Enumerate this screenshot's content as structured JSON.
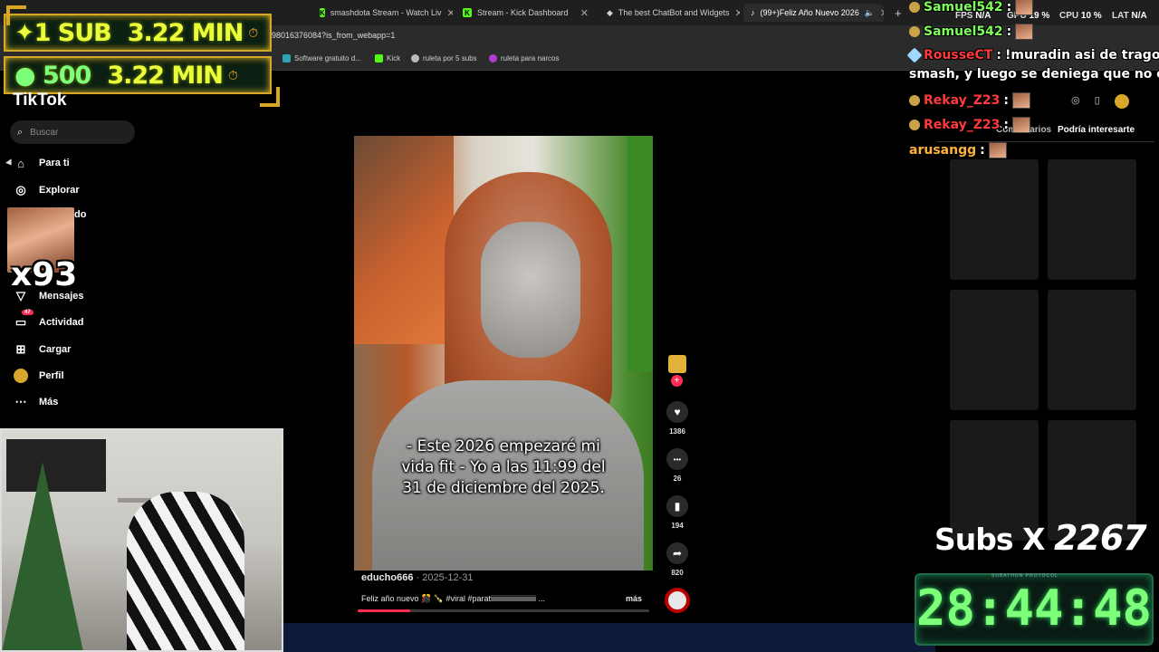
{
  "browser": {
    "tabs": [
      {
        "label": "smashdota Stream - Watch Liv"
      },
      {
        "label": "Stream - Kick Dashboard"
      },
      {
        "label": "The best ChatBot and Widgets"
      },
      {
        "label": "(99+)Feliz Año Nuevo 2026"
      }
    ],
    "url": "98016376084?is_from_webapp=1",
    "bookmarks": [
      {
        "label": "Software gratuito d..."
      },
      {
        "label": "Kick"
      },
      {
        "label": "ruleta por 5 subs"
      },
      {
        "label": "ruleta para narcos"
      }
    ]
  },
  "goals": [
    {
      "icon": "✦",
      "count": "1 SUB",
      "time": "3.22 MIN"
    },
    {
      "icon": "●",
      "count": "500",
      "time": "3.22 MIN"
    }
  ],
  "tiktok": {
    "logo": "TikTok",
    "search_placeholder": "Buscar",
    "nav": [
      {
        "label": "Para ti"
      },
      {
        "label": "Explorar"
      },
      {
        "label": "do"
      },
      {
        "label": "Mensajes"
      },
      {
        "label": "Actividad",
        "badge": "47"
      },
      {
        "label": "Cargar"
      },
      {
        "label": "Perfil"
      },
      {
        "label": "Más"
      }
    ],
    "emote_count": "x93"
  },
  "video": {
    "caption": "- Este 2026 empezaré mi vida fit - Yo a las 11:99 del 31 de diciembre del 2025.",
    "username": "educho666",
    "date": "· 2025-12-31",
    "description": "Feliz año nuevo 🎊 🍾 #viral #paratiiiiiiiiiiiiiiiiiiiiiiiii ...",
    "more": "más",
    "progress": 0.18,
    "actions": [
      {
        "icon": "♥",
        "count": "1386"
      },
      {
        "icon": "•••",
        "count": "26"
      },
      {
        "icon": "▮",
        "count": "194"
      },
      {
        "icon": "➦",
        "count": "820"
      }
    ]
  },
  "right_pane": {
    "tabs": [
      "Comentarios",
      "Podría interesarte"
    ]
  },
  "overlay_stats": {
    "fps": {
      "label": "FPS",
      "value": "N/A"
    },
    "gpu": {
      "label": "GPU",
      "value": "19 %"
    },
    "cpu": {
      "label": "CPU",
      "value": "10 %"
    },
    "lat": {
      "label": "LAT",
      "value": "N/A"
    }
  },
  "chat": [
    {
      "user": "Samuel542",
      "color": "#7dff5a",
      "text": ""
    },
    {
      "user": "Samuel542",
      "color": "#7dff5a",
      "text": ""
    },
    {
      "user": "RousseCT",
      "color": "#ff3a3a",
      "text": "!muradin asi de tragon es"
    },
    {
      "user": "",
      "color": "#ffffff",
      "text": "smash, y luego se deniega que no es asij"
    },
    {
      "user": "Rekay_Z23",
      "color": "#ff3a3a",
      "text": ""
    },
    {
      "user": "Rekay_Z23",
      "color": "#ff3a3a",
      "text": ""
    },
    {
      "user": "arusangg",
      "color": "#ffb23a",
      "text": ""
    }
  ],
  "subathon": {
    "subs_label": "Subs X",
    "subs_count": "2267",
    "timer_label": "SUBATHON PROTOCOL",
    "timer": "28:44:48"
  }
}
